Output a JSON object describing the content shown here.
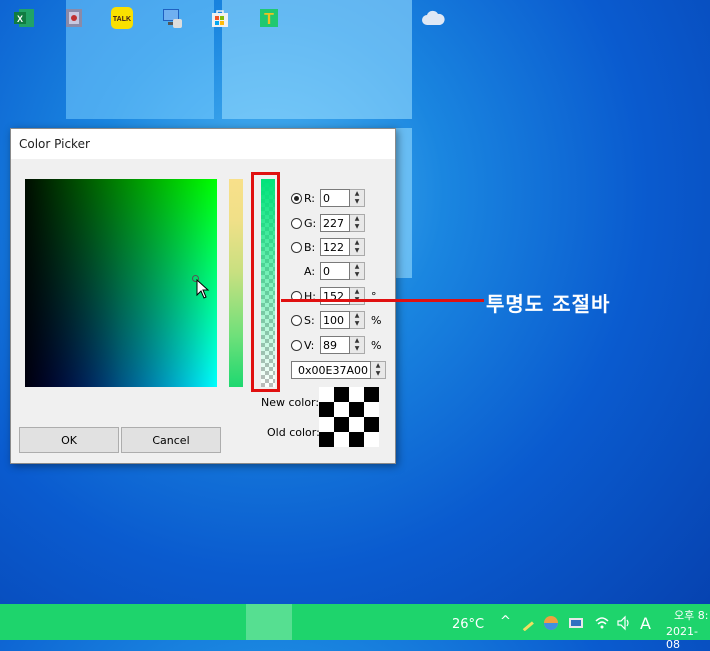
{
  "dialog": {
    "title": "Color Picker",
    "fields": {
      "r": {
        "label": "R:",
        "value": "0"
      },
      "g": {
        "label": "G:",
        "value": "227"
      },
      "b": {
        "label": "B:",
        "value": "122"
      },
      "a": {
        "label": "A:",
        "value": "0"
      },
      "h": {
        "label": "H:",
        "value": "152",
        "unit": "°"
      },
      "s": {
        "label": "S:",
        "value": "100",
        "unit": "%"
      },
      "v": {
        "label": "V:",
        "value": "89",
        "unit": "%"
      }
    },
    "hex_value": "0x00E37A00",
    "new_color_label": "New color:",
    "old_color_label": "Old color:",
    "ok_label": "OK",
    "cancel_label": "Cancel",
    "selected_mode": "R"
  },
  "annotation": {
    "text": "투명도 조절바",
    "color": "#e01010"
  },
  "taskbar": {
    "color": "#1ed46c",
    "apps": [
      "excel-icon",
      "app-r-icon",
      "kakaotalk-icon",
      "network-computer-icon",
      "store-icon",
      "app-t-icon"
    ],
    "kakao_label": "TALK",
    "weather": "26°C",
    "ime": "A",
    "time_partial": "오후 8:",
    "date_partial": "2021-08"
  }
}
